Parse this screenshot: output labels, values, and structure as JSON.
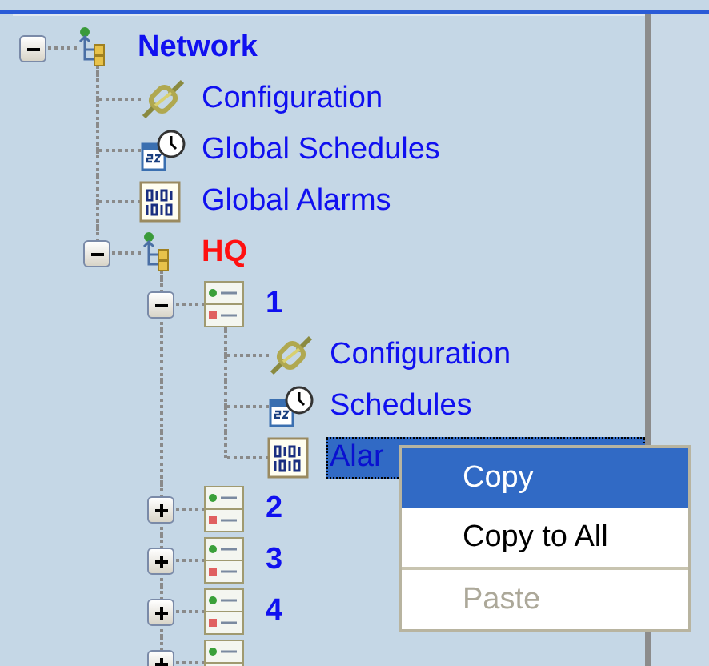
{
  "tree": [
    {
      "label": "Network",
      "kind": "network",
      "expanded": true,
      "selected": false,
      "children": [
        {
          "label": "Configuration",
          "kind": "configuration",
          "selected": false
        },
        {
          "label": "Global Schedules",
          "kind": "schedule",
          "selected": false
        },
        {
          "label": "Global Alarms",
          "kind": "alarms",
          "selected": false
        },
        {
          "label": "HQ",
          "kind": "site",
          "expanded": true,
          "alarm": true,
          "selected": false,
          "children": [
            {
              "label": "1",
              "kind": "controller",
              "expanded": true,
              "selected": false,
              "children": [
                {
                  "label": "Configuration",
                  "kind": "configuration",
                  "selected": false
                },
                {
                  "label": "Schedules",
                  "kind": "schedule",
                  "selected": false
                },
                {
                  "label": "Alar",
                  "kind": "alarms",
                  "selected": true
                }
              ]
            },
            {
              "label": "2",
              "kind": "controller",
              "expanded": false,
              "selected": false
            },
            {
              "label": "3",
              "kind": "controller",
              "expanded": false,
              "selected": false
            },
            {
              "label": "4",
              "kind": "controller",
              "expanded": false,
              "selected": false
            },
            {
              "kind": "controller",
              "expanded": false,
              "selected": false
            }
          ]
        }
      ]
    }
  ],
  "context_menu": [
    {
      "label": "Copy",
      "selected": true,
      "disabled": false
    },
    {
      "label": "Copy to All",
      "selected": false,
      "disabled": false
    },
    {
      "label": "Paste",
      "selected": false,
      "disabled": true
    }
  ]
}
